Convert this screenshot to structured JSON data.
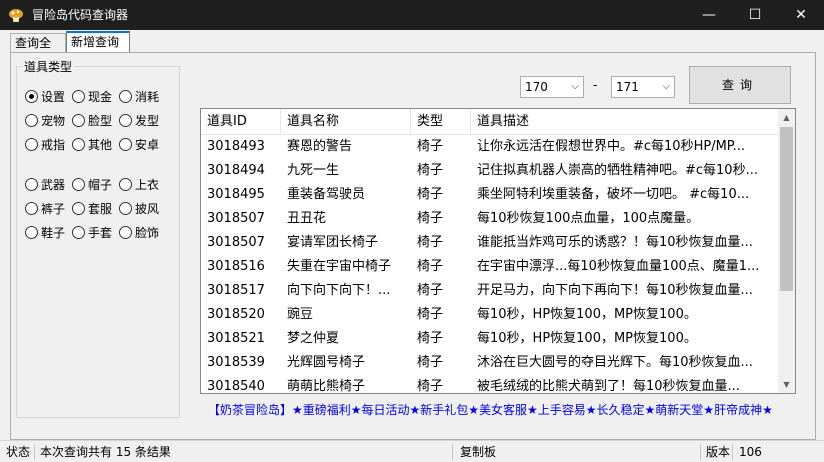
{
  "window": {
    "title": "冒险岛代码查询器",
    "min": "—",
    "max": "☐",
    "close": "✕"
  },
  "tabs": [
    {
      "label": "查询全部"
    },
    {
      "label": "新增查询"
    }
  ],
  "item_type": {
    "title": "道具类型",
    "options": [
      "设置",
      "现金",
      "消耗",
      "宠物",
      "脸型",
      "发型",
      "戒指",
      "其他",
      "安卓",
      "武器",
      "帽子",
      "上衣",
      "裤子",
      "套服",
      "披风",
      "鞋子",
      "手套",
      "脸饰"
    ],
    "selected": "设置"
  },
  "range": {
    "from": "170",
    "to": "171",
    "separator": "-"
  },
  "query_button": "查询",
  "table": {
    "headers": [
      "道具ID",
      "道具名称",
      "类型",
      "道具描述"
    ],
    "rows": [
      [
        "3018493",
        "赛恩的警告",
        "椅子",
        "让你永远活在假想世界中。#c每10秒HP/MP..."
      ],
      [
        "3018494",
        "九死一生",
        "椅子",
        "记住拟真机器人崇高的牺牲精神吧。#c每10秒..."
      ],
      [
        "3018495",
        "重装备驾驶员",
        "椅子",
        "乘坐阿特利埃重装备，破坏一切吧。 #c每10..."
      ],
      [
        "3018507",
        "丑丑花",
        "椅子",
        "每10秒恢复100点血量，100点魔量。"
      ],
      [
        "3018507",
        "宴请军团长椅子",
        "椅子",
        "谁能抵当炸鸡可乐的诱惑？！每10秒恢复血量..."
      ],
      [
        "3018516",
        "失重在宇宙中椅子",
        "椅子",
        "在宇宙中漂浮...每10秒恢复血量100点、魔量1..."
      ],
      [
        "3018517",
        "向下向下向下！...",
        "椅子",
        "开足马力，向下向下再向下！每10秒恢复血量..."
      ],
      [
        "3018520",
        "豌豆",
        "椅子",
        "每10秒，HP恢复100，MP恢复100。"
      ],
      [
        "3018521",
        "梦之仲夏",
        "椅子",
        "每10秒，HP恢复100，MP恢复100。"
      ],
      [
        "3018539",
        "光辉圆号椅子",
        "椅子",
        "沐浴在巨大圆号的夺目光辉下。每10秒恢复血..."
      ],
      [
        "3018540",
        "萌萌比熊椅子",
        "椅子",
        "被毛绒绒的比熊犬萌到了！每10秒恢复血量..."
      ]
    ]
  },
  "ad_text": "【奶茶冒险岛】★重磅福利★每日活动★新手礼包★美女客服★上手容易★长久稳定★萌新天堂★肝帝成神★",
  "status": {
    "label": "状态",
    "message": "本次查询共有 15 条结果",
    "clipboard": "复制板",
    "version_label": "版本",
    "version": "106"
  }
}
